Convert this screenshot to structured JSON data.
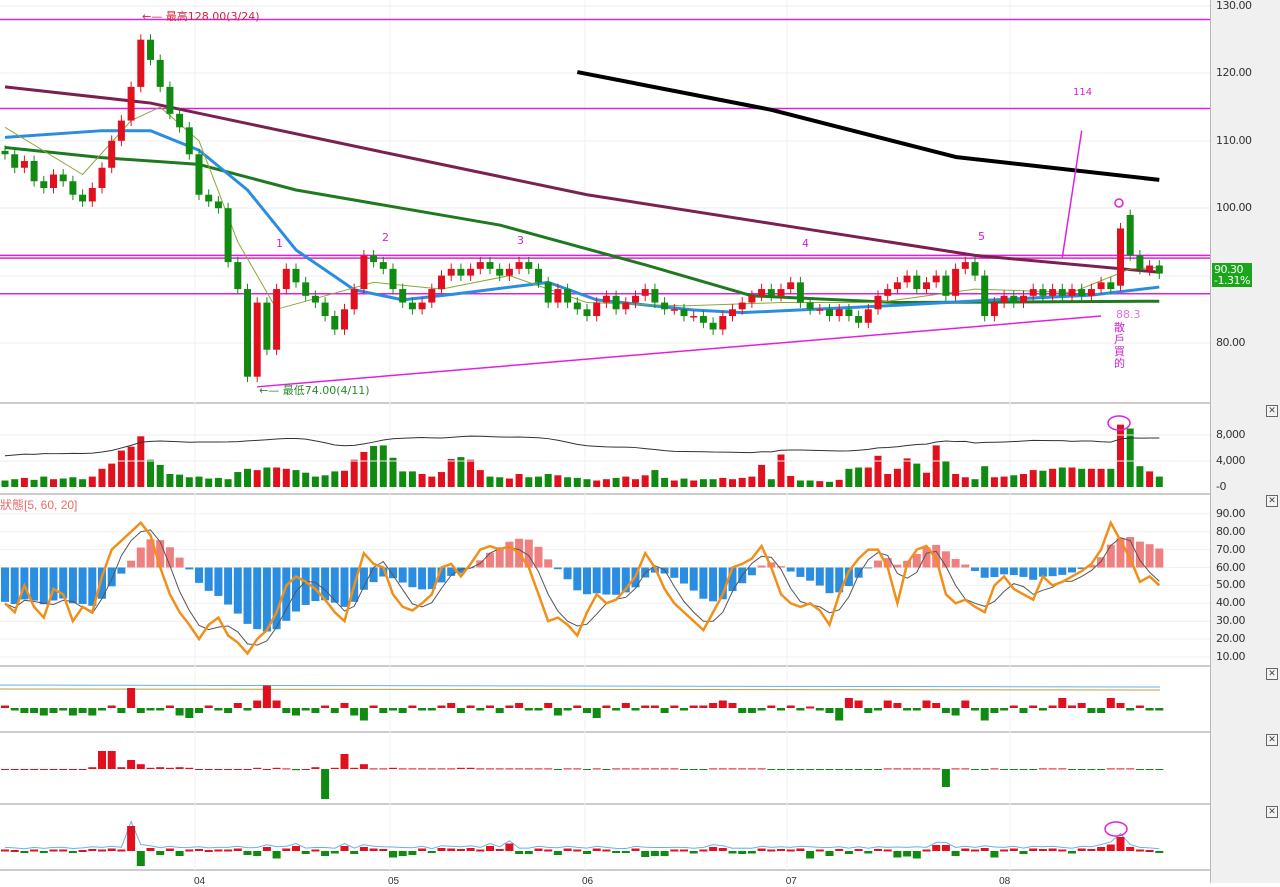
{
  "chart_data": {
    "type": "candlestick",
    "title": "",
    "price_axis": {
      "ylim": [
        70,
        131
      ],
      "ticks": [
        "130.00",
        "120.00",
        "110.00",
        "100.00",
        "80.00"
      ]
    },
    "x_labels": [
      "04",
      "05",
      "06",
      "07",
      "08"
    ],
    "x_label_index": [
      20,
      40,
      60,
      81,
      103
    ],
    "closes": [
      108,
      106,
      107,
      104,
      103,
      105,
      104,
      102,
      101,
      103,
      106,
      110,
      113,
      118,
      125,
      122,
      118,
      114,
      112,
      108,
      102,
      101,
      100,
      92,
      88,
      75,
      86,
      79,
      88,
      91,
      89,
      87,
      86,
      84,
      82,
      85,
      88,
      93,
      92,
      91,
      88,
      86,
      85,
      86,
      88,
      90,
      91,
      90,
      91,
      92,
      91,
      90,
      91,
      92,
      91,
      89,
      86,
      88,
      86,
      85,
      84,
      86,
      87,
      85,
      86,
      87,
      88,
      86,
      85,
      85,
      84,
      84,
      83,
      82,
      84,
      85,
      86,
      87,
      88,
      87,
      88,
      89,
      86,
      85,
      85,
      84,
      85,
      84,
      83,
      85,
      87,
      88,
      89,
      90,
      88,
      89,
      90,
      87,
      91,
      92,
      90,
      84,
      86,
      87,
      86,
      87,
      88,
      87,
      88,
      87,
      88,
      87,
      88,
      89,
      88,
      97,
      93,
      91,
      91.5,
      90.3
    ],
    "open_overrides": {
      "118": 90.8,
      "115": 88.5,
      "116": 99
    },
    "moving_averages": [
      {
        "name": "MA-long",
        "color": "#000000",
        "points": [
          [
            59,
            120.2
          ],
          [
            79,
            114.6
          ],
          [
            98,
            107.6
          ],
          [
            119,
            104.2
          ]
        ]
      },
      {
        "name": "MA-240",
        "color": "#7a2150",
        "points": [
          [
            0,
            118
          ],
          [
            15,
            115.6
          ],
          [
            40,
            108
          ],
          [
            60,
            102
          ],
          [
            80,
            97.5
          ],
          [
            100,
            93
          ],
          [
            119,
            90.5
          ]
        ]
      },
      {
        "name": "MA-60",
        "color": "#1f7a1f",
        "points": [
          [
            0,
            109
          ],
          [
            10,
            107.5
          ],
          [
            20,
            106.5
          ],
          [
            30,
            102.7
          ],
          [
            51,
            97.5
          ],
          [
            66,
            91.6
          ],
          [
            77,
            87
          ],
          [
            92,
            86
          ],
          [
            119,
            86.2
          ]
        ]
      },
      {
        "name": "MA-20",
        "color": "#2b8de0",
        "points": [
          [
            0,
            110.5
          ],
          [
            10,
            111.5
          ],
          [
            15,
            111.5
          ],
          [
            20,
            108.6
          ],
          [
            25,
            102.7
          ],
          [
            30,
            93.8
          ],
          [
            36,
            87.9
          ],
          [
            41,
            86.4
          ],
          [
            46,
            87.2
          ],
          [
            56,
            89
          ],
          [
            61,
            86.4
          ],
          [
            71,
            84.9
          ],
          [
            76,
            84.5
          ],
          [
            92,
            85.6
          ],
          [
            102,
            86.4
          ],
          [
            112,
            87.1
          ],
          [
            119,
            88.3
          ]
        ]
      },
      {
        "name": "MA-5",
        "color": "#8aa838",
        "points": [
          [
            0,
            112
          ],
          [
            8,
            105
          ],
          [
            13,
            113
          ],
          [
            16,
            115
          ],
          [
            20,
            110
          ],
          [
            24,
            95
          ],
          [
            28,
            85
          ],
          [
            33,
            87
          ],
          [
            38,
            89
          ],
          [
            45,
            88
          ],
          [
            52,
            90
          ],
          [
            60,
            86
          ],
          [
            70,
            85.5
          ],
          [
            80,
            86
          ],
          [
            90,
            86
          ],
          [
            100,
            88
          ],
          [
            110,
            87.5
          ],
          [
            116,
            91
          ],
          [
            119,
            91.2
          ]
        ]
      }
    ],
    "horizontal_lines": [
      128,
      114.8,
      93,
      92.6,
      87.3
    ],
    "trendline": [
      [
        26,
        73.5
      ],
      [
        113,
        84
      ]
    ],
    "projection_line": [
      [
        109,
        92.7
      ],
      [
        111,
        111.5
      ]
    ],
    "annotations": {
      "high": "←— 最高128.00(3/24)",
      "low": "←— 最低74.00(4/11)",
      "wave_labels": [
        "1",
        "2",
        "3",
        "4",
        "5"
      ],
      "target": "114",
      "support": "88.3",
      "note": "散戶買的"
    },
    "last_price": "90.30",
    "last_change": "-1.31%",
    "volume": {
      "ticks": [
        "8,000",
        "4,000",
        "-0"
      ],
      "values": [
        1.0,
        1.2,
        1.4,
        1.1,
        1.6,
        1.2,
        1.3,
        1.5,
        1.2,
        1.6,
        2.8,
        3.6,
        5.6,
        6.2,
        7.8,
        4.2,
        3.4,
        2.0,
        1.9,
        1.5,
        1.6,
        1.3,
        1.4,
        1.2,
        2.3,
        2.8,
        2.6,
        3.0,
        3.0,
        2.8,
        2.6,
        2.2,
        1.6,
        1.8,
        2.4,
        2.5,
        4.2,
        5.4,
        6.3,
        6.4,
        4.5,
        2.4,
        2.4,
        2.0,
        1.6,
        2.3,
        4.3,
        4.6,
        4.2,
        2.6,
        1.6,
        1.5,
        1.3,
        2.0,
        1.5,
        1.6,
        2.0,
        1.8,
        1.5,
        1.4,
        1.2,
        1.0,
        1.2,
        1.4,
        1.6,
        1.2,
        1.8,
        2.6,
        1.4,
        1.0,
        1.3,
        1.0,
        1.2,
        1.2,
        1.4,
        1.2,
        1.4,
        1.6,
        3.4,
        1.2,
        5.0,
        1.7,
        1.0,
        1.0,
        0.9,
        0.8,
        1.1,
        2.8,
        3.0,
        3.0,
        4.8,
        2.0,
        2.8,
        4.4,
        3.6,
        2.2,
        6.4,
        4.0,
        2.0,
        1.5,
        1.2,
        3.2,
        1.5,
        1.6,
        1.8,
        2.0,
        2.6,
        2.5,
        2.8,
        3.0,
        3.0,
        2.8,
        2.8,
        2.8,
        2.8,
        9.6,
        9.0,
        3.2,
        2.4,
        1.6
      ],
      "unit": "thousands"
    },
    "kd": {
      "title": "狀態[5, 60, 20]",
      "ticks": [
        "90.00",
        "80.00",
        "70.00",
        "60.00",
        "50.00",
        "40.00",
        "30.00",
        "20.00",
        "10.00"
      ],
      "k": [
        40,
        35,
        50,
        38,
        32,
        48,
        45,
        30,
        38,
        35,
        55,
        70,
        75,
        80,
        85,
        78,
        60,
        45,
        35,
        28,
        20,
        28,
        32,
        22,
        18,
        12,
        20,
        25,
        35,
        50,
        55,
        52,
        48,
        42,
        35,
        30,
        50,
        68,
        62,
        60,
        45,
        38,
        36,
        40,
        45,
        60,
        62,
        55,
        62,
        70,
        72,
        70,
        72,
        68,
        60,
        45,
        30,
        32,
        28,
        22,
        35,
        45,
        40,
        42,
        48,
        55,
        68,
        60,
        48,
        40,
        35,
        30,
        25,
        35,
        45,
        60,
        62,
        65,
        72,
        60,
        45,
        40,
        38,
        40,
        36,
        28,
        45,
        58,
        65,
        70,
        70,
        60,
        40,
        62,
        70,
        72,
        65,
        45,
        40,
        42,
        38,
        35,
        50,
        55,
        48,
        45,
        42,
        55,
        50,
        52,
        55,
        58,
        62,
        70,
        85,
        75,
        65,
        52,
        55,
        50
      ]
    },
    "panel4": [
      0.5,
      -0.5,
      -1,
      -1,
      -1.5,
      -1,
      -0.5,
      -1.5,
      -1,
      -1.5,
      -0.5,
      0.5,
      -1,
      4,
      -1,
      -0.5,
      -0.5,
      0.5,
      -1.5,
      -2,
      -1,
      0.5,
      -0.5,
      -1,
      1,
      -0.5,
      1.5,
      4.5,
      1.5,
      -1,
      -1.5,
      -0.5,
      -1,
      0.5,
      -1,
      1,
      -1.5,
      -2.5,
      0.5,
      -1,
      -0.5,
      -1,
      0.5,
      -0.5,
      -0.5,
      0.5,
      1,
      -1,
      0.5,
      -0.5,
      0.5,
      -1,
      0.5,
      1,
      -0.5,
      -0.5,
      1,
      -1.5,
      -0.5,
      0.5,
      -1,
      -2,
      0.5,
      -0.5,
      1,
      -0.5,
      0.5,
      0.5,
      -1,
      0.5,
      -0.5,
      0.5,
      0.5,
      1,
      1.5,
      1,
      -1,
      -1,
      -0.5,
      0.5,
      -0.5,
      0.5,
      -0.5,
      0.3,
      -0.5,
      -1,
      -2.5,
      2,
      1.5,
      -1,
      -0.5,
      1.5,
      1,
      -0.5,
      -0.5,
      1.5,
      1,
      -1,
      -1.5,
      1.5,
      -0.5,
      -2.5,
      -1,
      -0.5,
      0.5,
      -1,
      0.5,
      -0.5,
      0.5,
      2,
      0.5,
      1,
      -1,
      -1,
      2,
      1,
      -0.5,
      0.5,
      -0.5,
      -0.5
    ],
    "panel5": [
      0,
      0,
      0,
      0,
      0,
      0,
      0,
      0,
      0,
      0.3,
      3,
      3,
      0.3,
      1.5,
      0.8,
      0.2,
      0.3,
      0.2,
      0.3,
      0.2,
      0,
      0,
      0,
      0,
      0,
      0,
      0.2,
      0,
      0.2,
      0.1,
      -0.2,
      0,
      0.3,
      -5,
      0.2,
      2.5,
      0.2,
      0.8,
      0.1,
      0.1,
      0.2,
      0.1,
      0.1,
      0.1,
      0.1,
      0.1,
      0.1,
      0.2,
      0.2,
      0.1,
      0.1,
      0.1,
      0.1,
      0.1,
      0.1,
      0.1,
      0.1,
      -0.1,
      0.1,
      0.1,
      -0.1,
      0.1,
      -0.1,
      0.1,
      0.1,
      0.1,
      0.1,
      0.1,
      0.1,
      0.1,
      -0.1,
      -0.1,
      -0.1,
      0.1,
      0.1,
      0.1,
      0.1,
      0.1,
      0.1,
      -0.1,
      -0.1,
      -0.1,
      -0.1,
      -0.1,
      -0.1,
      -0.1,
      -0.1,
      -0.1,
      -0.1,
      -0.1,
      -0.1,
      0.1,
      0.1,
      0.1,
      0.1,
      0.1,
      0.1,
      -3,
      0.1,
      0.1,
      -0.1,
      -0.1,
      0.1,
      -0.1,
      -0.1,
      -0.1,
      -0.1,
      0.1,
      0.1,
      0.1,
      -0.1,
      -0.1,
      -0.1,
      -0.1,
      0.1,
      0.1,
      0.1,
      -0.1,
      -0.1,
      -0.1
    ],
    "panel6": [
      0.3,
      0.2,
      -0.2,
      0.3,
      -0.4,
      0.3,
      0.3,
      -0.3,
      0.2,
      0.4,
      0.3,
      0.5,
      0.3,
      5,
      -3,
      0.6,
      -0.8,
      0.5,
      -1,
      0.3,
      0.4,
      0.2,
      0.3,
      0.3,
      0.5,
      -0.8,
      -1,
      0.8,
      -1.5,
      0.5,
      1,
      -0.6,
      0.3,
      -1,
      -0.5,
      1,
      -0.6,
      0.8,
      0.5,
      0.4,
      -1.3,
      -1,
      -0.8,
      0.5,
      -0.3,
      0.6,
      0.5,
      0.4,
      0.6,
      0.3,
      1,
      0.4,
      1.5,
      -0.6,
      -0.6,
      0.5,
      0.3,
      -0.8,
      0.5,
      0.3,
      -0.6,
      0.5,
      0.3,
      -0.4,
      -0.3,
      0.5,
      -1.2,
      -1,
      -1,
      0.3,
      0.3,
      -0.5,
      0.3,
      0.8,
      0.6,
      -0.5,
      -0.6,
      -0.5,
      0.5,
      0.3,
      0.4,
      0.3,
      0.5,
      -1.5,
      0.3,
      -1,
      0.4,
      -0.6,
      0.4,
      -0.5,
      0.4,
      0.3,
      -1.3,
      -1.1,
      -1.5,
      0.3,
      1.2,
      1.2,
      -1,
      0.5,
      0.3,
      0.6,
      -1.3,
      0.3,
      0.5,
      -0.6,
      0.5,
      0.4,
      0.5,
      0.3,
      -0.5,
      0.5,
      0.4,
      0.8,
      1.3,
      2.8,
      0.8,
      0.3,
      0.2,
      -0.2
    ]
  }
}
